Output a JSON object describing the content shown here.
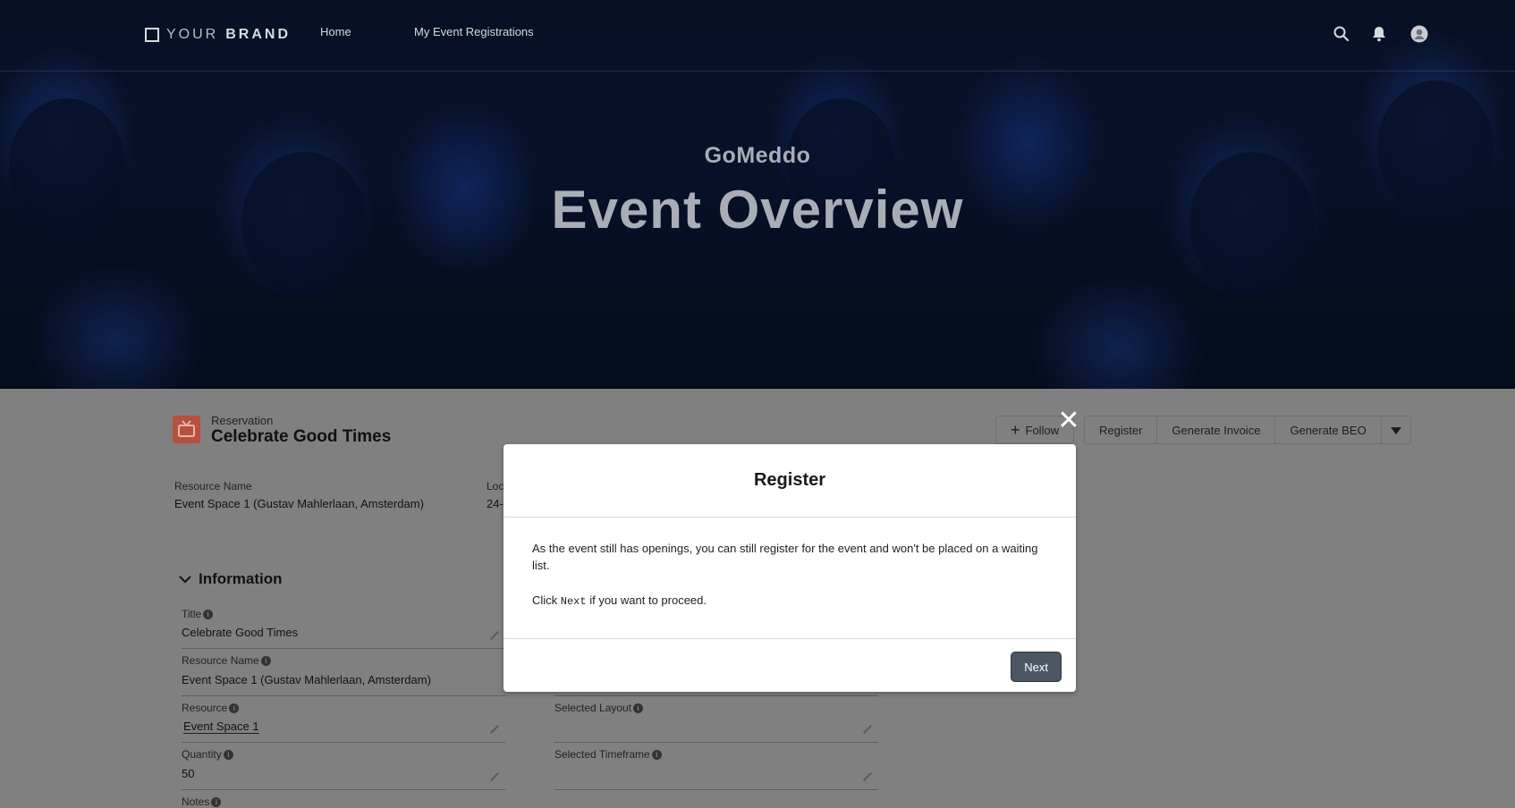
{
  "nav": {
    "brand_your": "YOUR",
    "brand_brand": "BRAND",
    "links": [
      "Home",
      "My Event Registrations"
    ],
    "icons": [
      "search-icon",
      "bell-icon",
      "user-avatar-icon"
    ]
  },
  "hero": {
    "subtitle": "GoMeddo",
    "title": "Event Overview"
  },
  "record": {
    "type": "Reservation",
    "name": "Celebrate Good Times",
    "actions": {
      "follow": "Follow",
      "register": "Register",
      "generate_invoice": "Generate Invoice",
      "generate_beo": "Generate BEO"
    },
    "highlights": {
      "resource_name_label": "Resource Name",
      "resource_name_value": "Event Space 1 (Gustav Mahlerlaan, Amsterdam)",
      "location_label": "Loc",
      "location_value": "24-"
    },
    "section_title": "Information",
    "fields": {
      "title_label": "Title",
      "title_value": "Celebrate Good Times",
      "resource_name_label": "Resource Name",
      "resource_name_value": "Event Space 1 (Gustav Mahlerlaan, Amsterdam)",
      "resource_label": "Resource",
      "resource_value": "Event Space 1",
      "quantity_label": "Quantity",
      "quantity_value": "50",
      "notes_label": "Notes",
      "selected_layout_label": "Selected Layout",
      "selected_timeframe_label": "Selected Timeframe"
    }
  },
  "modal": {
    "title": "Register",
    "message": "As the event still has openings, you can still register for the event and won't be placed on a waiting list.",
    "instruction_pre": "Click ",
    "instruction_keyword": "Next",
    "instruction_post": " if you want to proceed.",
    "next_button": "Next",
    "close_symbol": "✕"
  },
  "colors": {
    "overlay": "#808080",
    "next_button": "#4c5663",
    "record_icon": "#b5513d"
  }
}
